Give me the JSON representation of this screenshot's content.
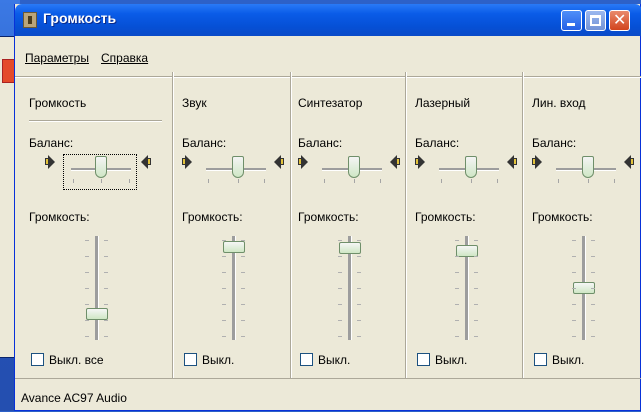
{
  "window": {
    "title": "Громкость"
  },
  "menu": [
    {
      "label": "Параметры"
    },
    {
      "label": "Справка"
    }
  ],
  "channels": [
    {
      "name": "Громкость",
      "balance_label": "Баланс:",
      "volume_label": "Громкость:",
      "mute_label": "Выкл. все",
      "volume_level": 0.22
    },
    {
      "name": "Звук",
      "balance_label": "Баланс:",
      "volume_label": "Громкость:",
      "mute_label": "Выкл.",
      "volume_level": 0.95
    },
    {
      "name": "Синтезатор",
      "balance_label": "Баланс:",
      "volume_label": "Громкость:",
      "mute_label": "Выкл.",
      "volume_level": 0.93
    },
    {
      "name": "Лазерный",
      "balance_label": "Баланс:",
      "volume_label": "Громкость:",
      "mute_label": "Выкл.",
      "volume_level": 0.9
    },
    {
      "name": "Лин. вход",
      "balance_label": "Баланс:",
      "volume_label": "Громкость:",
      "mute_label": "Выкл.",
      "volume_level": 0.5
    }
  ],
  "status": {
    "device": "Avance AC97 Audio"
  }
}
